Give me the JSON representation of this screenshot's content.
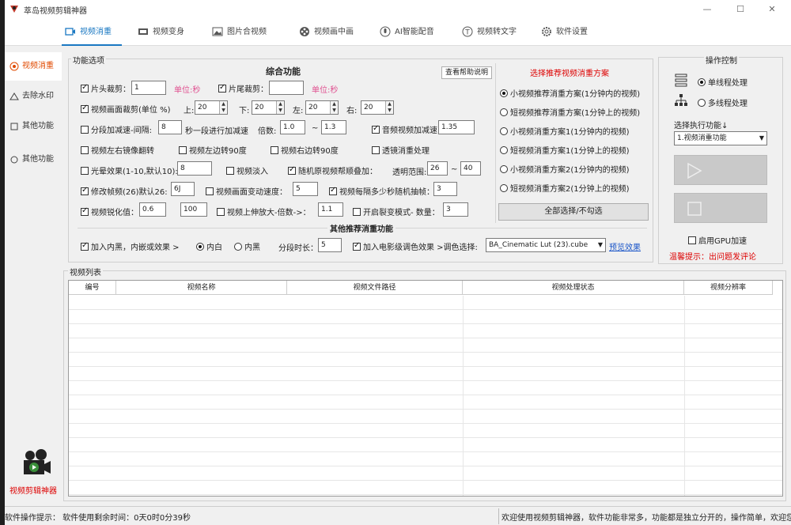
{
  "window": {
    "title": "萃岛视频剪辑神器",
    "minimize": "—",
    "maximize": "☐",
    "close": "✕"
  },
  "tabs": [
    {
      "label": "视频消重"
    },
    {
      "label": "视频变身"
    },
    {
      "label": "图片合视频"
    },
    {
      "label": "视频画中画"
    },
    {
      "label": "AI智能配音"
    },
    {
      "label": "视频转文字"
    },
    {
      "label": "软件设置"
    }
  ],
  "sidebar": {
    "items": [
      {
        "label": "视频消重"
      },
      {
        "label": "去除水印"
      },
      {
        "label": "其他功能"
      },
      {
        "label": "其他功能"
      }
    ],
    "promo": "视频剪辑神器"
  },
  "func": {
    "group_title": "功能选项",
    "section_title": "综合功能",
    "help_btn": "查看帮助说明",
    "r1": {
      "c1": "片头裁剪：",
      "v1": "1",
      "u1": "单位:秒",
      "c2": "片尾裁剪：",
      "v2": "",
      "u2": "单位:秒"
    },
    "r2": {
      "c1": "视频画面裁剪(单位 %)",
      "l_top": "上:",
      "v_top": "20",
      "l_down": "下:",
      "v_down": "20",
      "l_left": "左:",
      "v_left": "20",
      "l_right": "右:",
      "v_right": "20"
    },
    "r3": {
      "c1": "分段加减速-间隔:",
      "v1": "8",
      "l1": "秒一段进行加减速",
      "l2": "倍数:",
      "v2": "1.0",
      "dash": "~",
      "v3": "1.3",
      "c2": "音频视频加减速:",
      "v4": "1.35"
    },
    "r4": {
      "c1": "视频左右镜像翻转",
      "c2": "视频左边转90度",
      "c3": "视频右边转90度",
      "c4": "透镜消重处理"
    },
    "r5": {
      "c1": "光晕效果(1-10,默认10):",
      "v1": "8",
      "c2": "视频淡入",
      "c3": "随机原视频帮顺叠加：",
      "l1": "透明范围:",
      "v2": "26",
      "dash": "~",
      "v3": "40"
    },
    "r6": {
      "c1": "修改帧频(26)默认26:",
      "v1": "6J",
      "c2": "视频画面变动速度：",
      "v2": "5",
      "c3": "视频每隔多少秒随机抽帧：",
      "v3": "3"
    },
    "r7": {
      "c1": "视频锐化值：",
      "v1": "0.6",
      "v2": "100",
      "c2": "视频上伸放大-倍数->：",
      "v3": "1.1",
      "c3": "开启裂变模式- 数量：",
      "v4": "3"
    },
    "other_title": "其他推荐消重功能",
    "r8": {
      "c1": "加入内黑，内嵌或效果 >",
      "rad1": "内白",
      "rad2": "内黑",
      "l1": "分段时长：",
      "v1": "5",
      "c2": "加入电影级调色效果 >调色选择:",
      "lut": "BA_Cinematic Lut (23).cube",
      "link": "预览效果"
    }
  },
  "scheme": {
    "title": "选择推荐视频消重方案",
    "options": [
      "小视频推荐消重方案(1分钟内的视频)",
      "短视频推荐消重方案(1分钟上的视频)",
      "小视频消重方案1(1分钟内的视频)",
      "短视频消重方案1(1分钟上的视频)",
      "小视频消重方案2(1分钟内的视频)",
      "短视频消重方案2(1分钟上的视频)"
    ],
    "selected_index": 0,
    "select_all": "全部选择/不勾选"
  },
  "control": {
    "title": "操作控制",
    "mode1": "单线程处理",
    "mode2": "多线程处理",
    "select_label": "选择执行功能↓",
    "select_value": "1.视频消重功能",
    "gpu": "启用GPU加速",
    "warning": "温馨提示：出问题发评论"
  },
  "list": {
    "title": "视频列表",
    "columns": [
      "编号",
      "视频名称",
      "视频文件路径",
      "视频处理状态",
      "视频分辨率"
    ]
  },
  "status": {
    "left": "软件操作提示：  软件使用剩余时间：0天0时0分39秒",
    "right": "欢迎使用视频剪辑神器，软件功能非常多，功能都是独立分开的，操作简单，欢迎您"
  }
}
